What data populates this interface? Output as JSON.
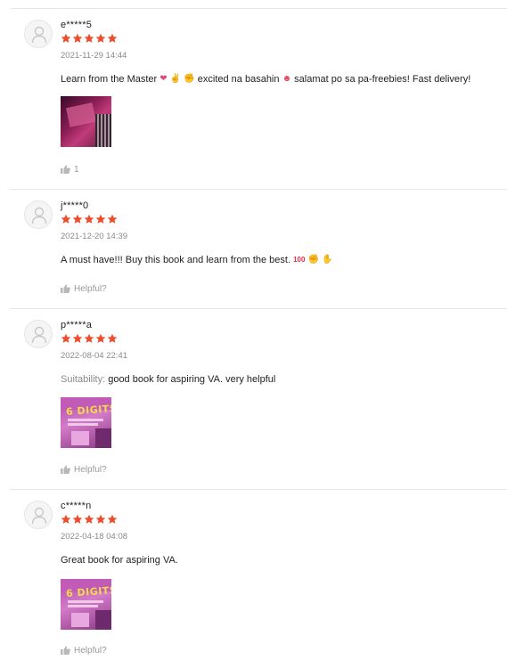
{
  "reviews": [
    {
      "username": "e*****5",
      "rating": 5,
      "date": "2021-11-29 14:44",
      "comment_text": "Learn from the Master",
      "comment_text2": "excited na basahin",
      "comment_text3": "salamat po sa pa-freebies! Fast delivery!",
      "has_photo": true,
      "like_label": "1"
    },
    {
      "username": "j*****0",
      "rating": 5,
      "date": "2021-12-20 14:39",
      "comment_text": "A must have!!! Buy this book and learn from the best.",
      "emoji_100": "100",
      "has_photo": false,
      "like_label": "Helpful?"
    },
    {
      "username": "p*****a",
      "rating": 5,
      "date": "2022-08-04 22:41",
      "comment_label": "Suitability:",
      "comment_text": "good book for aspiring VA. very helpful",
      "has_photo": true,
      "photo_text": "6 DIGITS",
      "like_label": "Helpful?"
    },
    {
      "username": "c*****n",
      "rating": 5,
      "date": "2022-04-18 04:08",
      "comment_text": "Great book for aspiring VA.",
      "has_photo": true,
      "photo_text": "6 DIGITS",
      "like_label": "Helpful?"
    }
  ],
  "icons": {
    "avatar": "user-silhouette-icon",
    "star": "star-filled-icon",
    "like": "thumbs-up-icon"
  },
  "colors": {
    "star": "#ee4d2d",
    "muted_text": "#8a8a8a",
    "divider": "#e8e8e8"
  }
}
